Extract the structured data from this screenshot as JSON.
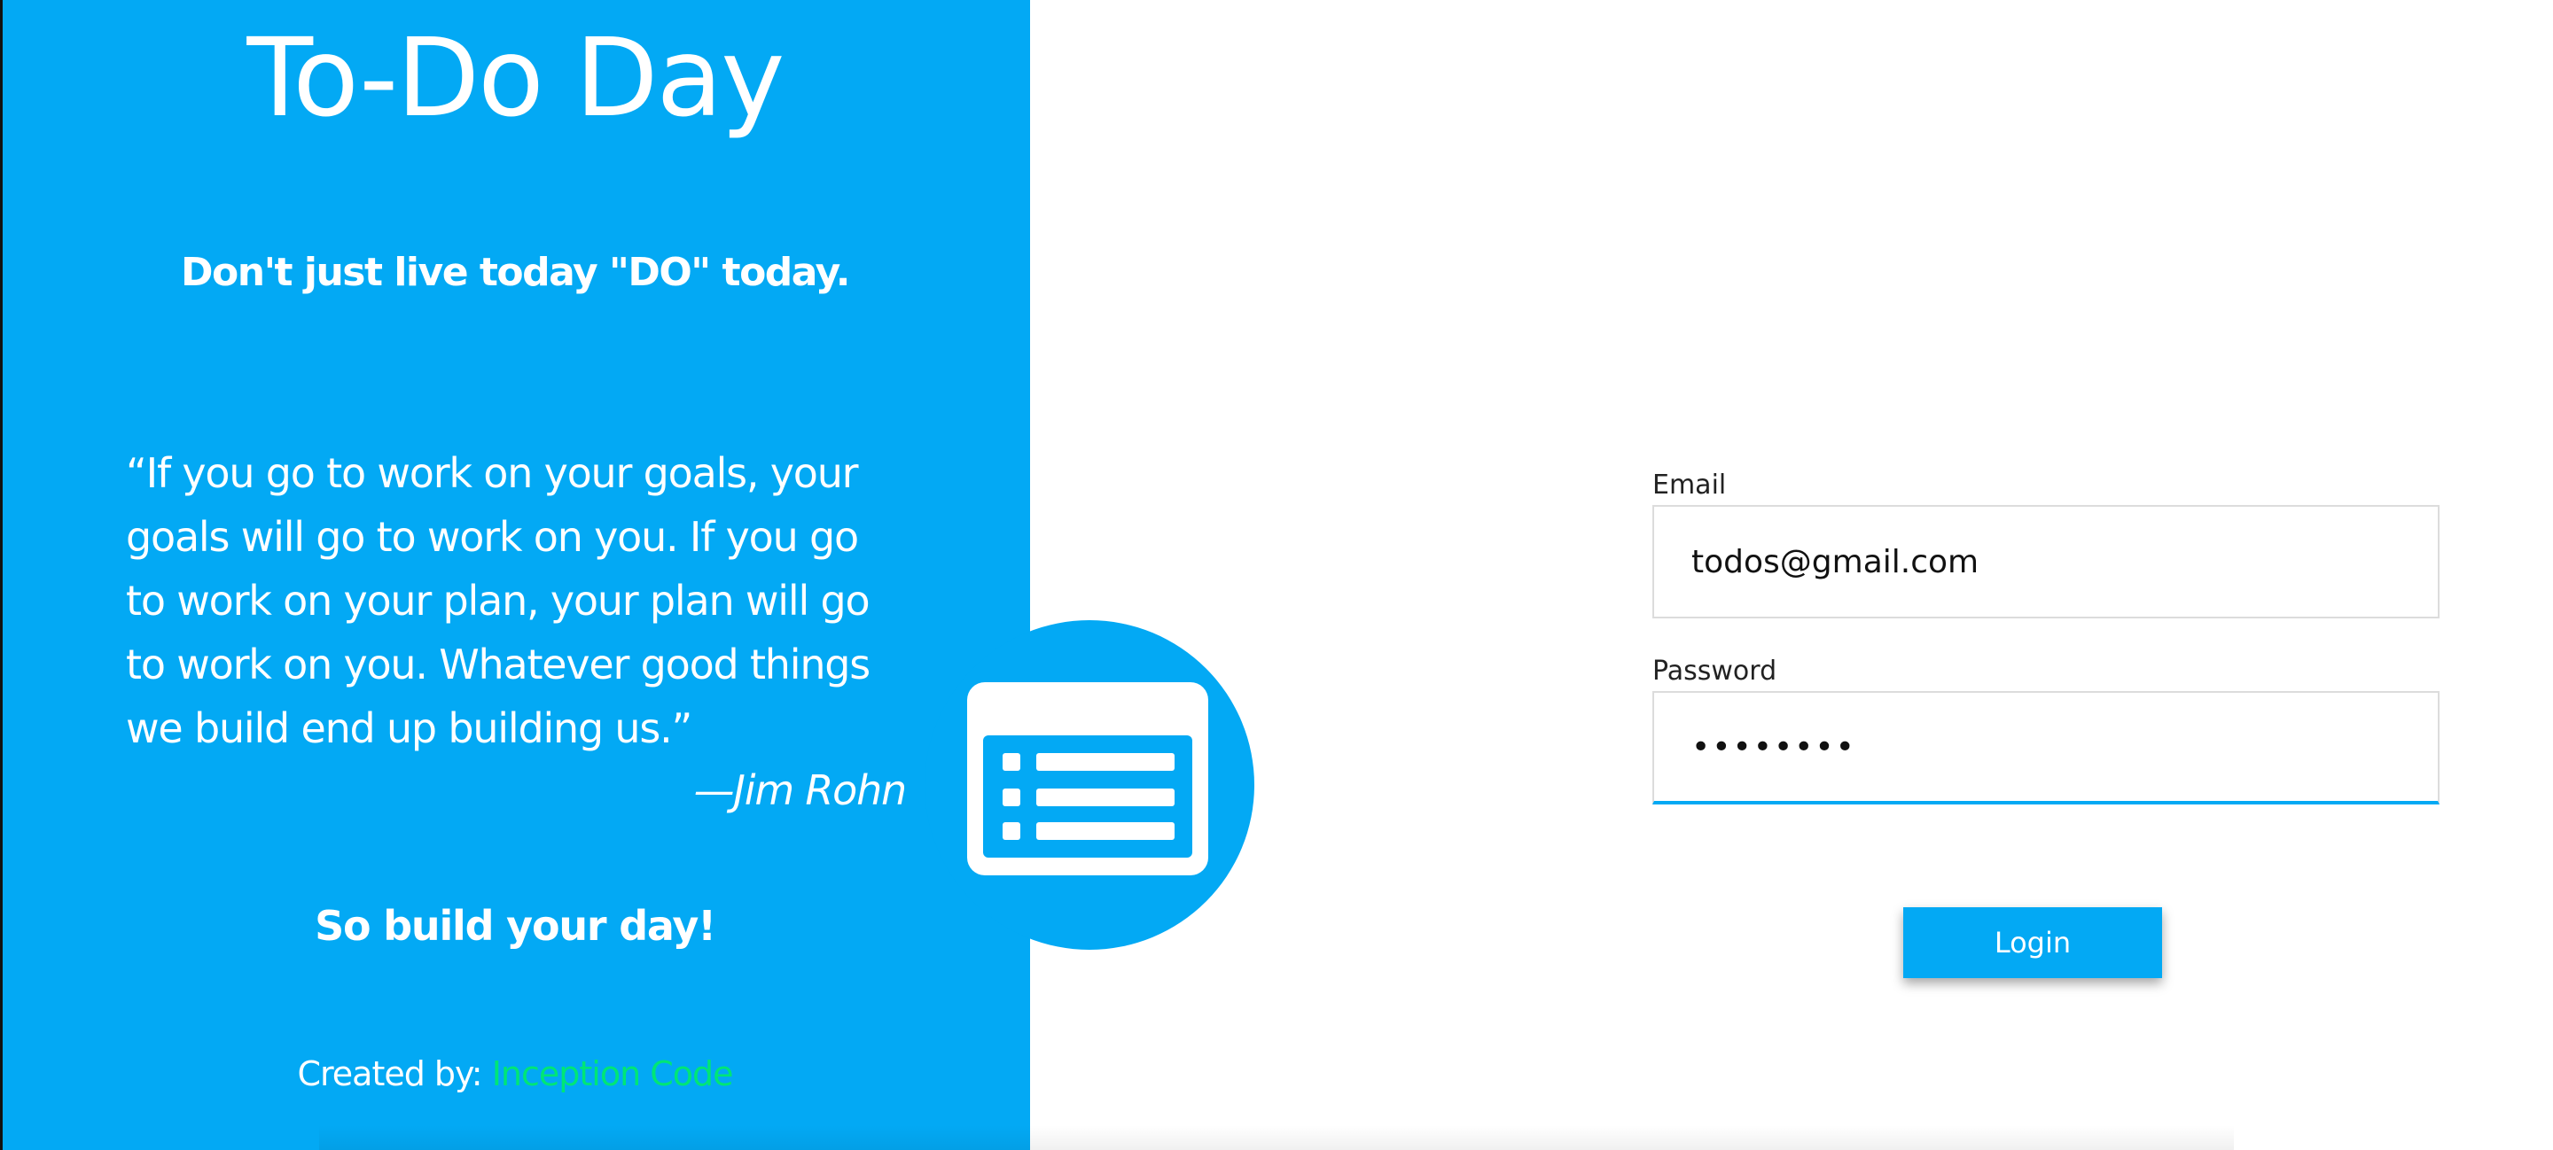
{
  "hero": {
    "title": "To-Do Day",
    "tagline": "Don't just live today \"DO\" today.",
    "quote": "“If you go to work on your goals, your\ngoals will go to work on you. If you go\nto work on your plan, your plan will go\nto work on you. Whatever good things\nwe build end up building us.”",
    "quote_author": "—Jim Rohn",
    "motto": "So build your day!",
    "credit_prefix": "Created by:",
    "credit_link": "Inception Code"
  },
  "form": {
    "email_label": "Email",
    "email_value": "todos@gmail.com",
    "password_label": "Password",
    "password_value": "••••••••",
    "login_label": "Login"
  },
  "icons": {
    "logo": "todo-list-icon"
  },
  "colors": {
    "primary": "#03a9f4",
    "credit_link": "#00e676",
    "background": "#ffffff"
  }
}
